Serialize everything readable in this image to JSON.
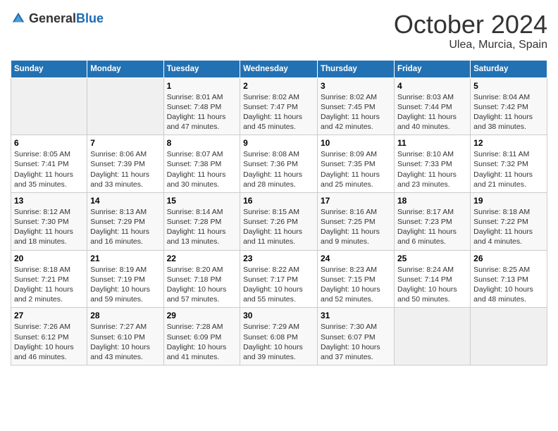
{
  "header": {
    "logo_general": "General",
    "logo_blue": "Blue",
    "month": "October 2024",
    "location": "Ulea, Murcia, Spain"
  },
  "days_of_week": [
    "Sunday",
    "Monday",
    "Tuesday",
    "Wednesday",
    "Thursday",
    "Friday",
    "Saturday"
  ],
  "weeks": [
    [
      {
        "day": "",
        "info": ""
      },
      {
        "day": "",
        "info": ""
      },
      {
        "day": "1",
        "info": "Sunrise: 8:01 AM\nSunset: 7:48 PM\nDaylight: 11 hours and 47 minutes."
      },
      {
        "day": "2",
        "info": "Sunrise: 8:02 AM\nSunset: 7:47 PM\nDaylight: 11 hours and 45 minutes."
      },
      {
        "day": "3",
        "info": "Sunrise: 8:02 AM\nSunset: 7:45 PM\nDaylight: 11 hours and 42 minutes."
      },
      {
        "day": "4",
        "info": "Sunrise: 8:03 AM\nSunset: 7:44 PM\nDaylight: 11 hours and 40 minutes."
      },
      {
        "day": "5",
        "info": "Sunrise: 8:04 AM\nSunset: 7:42 PM\nDaylight: 11 hours and 38 minutes."
      }
    ],
    [
      {
        "day": "6",
        "info": "Sunrise: 8:05 AM\nSunset: 7:41 PM\nDaylight: 11 hours and 35 minutes."
      },
      {
        "day": "7",
        "info": "Sunrise: 8:06 AM\nSunset: 7:39 PM\nDaylight: 11 hours and 33 minutes."
      },
      {
        "day": "8",
        "info": "Sunrise: 8:07 AM\nSunset: 7:38 PM\nDaylight: 11 hours and 30 minutes."
      },
      {
        "day": "9",
        "info": "Sunrise: 8:08 AM\nSunset: 7:36 PM\nDaylight: 11 hours and 28 minutes."
      },
      {
        "day": "10",
        "info": "Sunrise: 8:09 AM\nSunset: 7:35 PM\nDaylight: 11 hours and 25 minutes."
      },
      {
        "day": "11",
        "info": "Sunrise: 8:10 AM\nSunset: 7:33 PM\nDaylight: 11 hours and 23 minutes."
      },
      {
        "day": "12",
        "info": "Sunrise: 8:11 AM\nSunset: 7:32 PM\nDaylight: 11 hours and 21 minutes."
      }
    ],
    [
      {
        "day": "13",
        "info": "Sunrise: 8:12 AM\nSunset: 7:30 PM\nDaylight: 11 hours and 18 minutes."
      },
      {
        "day": "14",
        "info": "Sunrise: 8:13 AM\nSunset: 7:29 PM\nDaylight: 11 hours and 16 minutes."
      },
      {
        "day": "15",
        "info": "Sunrise: 8:14 AM\nSunset: 7:28 PM\nDaylight: 11 hours and 13 minutes."
      },
      {
        "day": "16",
        "info": "Sunrise: 8:15 AM\nSunset: 7:26 PM\nDaylight: 11 hours and 11 minutes."
      },
      {
        "day": "17",
        "info": "Sunrise: 8:16 AM\nSunset: 7:25 PM\nDaylight: 11 hours and 9 minutes."
      },
      {
        "day": "18",
        "info": "Sunrise: 8:17 AM\nSunset: 7:23 PM\nDaylight: 11 hours and 6 minutes."
      },
      {
        "day": "19",
        "info": "Sunrise: 8:18 AM\nSunset: 7:22 PM\nDaylight: 11 hours and 4 minutes."
      }
    ],
    [
      {
        "day": "20",
        "info": "Sunrise: 8:18 AM\nSunset: 7:21 PM\nDaylight: 11 hours and 2 minutes."
      },
      {
        "day": "21",
        "info": "Sunrise: 8:19 AM\nSunset: 7:19 PM\nDaylight: 10 hours and 59 minutes."
      },
      {
        "day": "22",
        "info": "Sunrise: 8:20 AM\nSunset: 7:18 PM\nDaylight: 10 hours and 57 minutes."
      },
      {
        "day": "23",
        "info": "Sunrise: 8:22 AM\nSunset: 7:17 PM\nDaylight: 10 hours and 55 minutes."
      },
      {
        "day": "24",
        "info": "Sunrise: 8:23 AM\nSunset: 7:15 PM\nDaylight: 10 hours and 52 minutes."
      },
      {
        "day": "25",
        "info": "Sunrise: 8:24 AM\nSunset: 7:14 PM\nDaylight: 10 hours and 50 minutes."
      },
      {
        "day": "26",
        "info": "Sunrise: 8:25 AM\nSunset: 7:13 PM\nDaylight: 10 hours and 48 minutes."
      }
    ],
    [
      {
        "day": "27",
        "info": "Sunrise: 7:26 AM\nSunset: 6:12 PM\nDaylight: 10 hours and 46 minutes."
      },
      {
        "day": "28",
        "info": "Sunrise: 7:27 AM\nSunset: 6:10 PM\nDaylight: 10 hours and 43 minutes."
      },
      {
        "day": "29",
        "info": "Sunrise: 7:28 AM\nSunset: 6:09 PM\nDaylight: 10 hours and 41 minutes."
      },
      {
        "day": "30",
        "info": "Sunrise: 7:29 AM\nSunset: 6:08 PM\nDaylight: 10 hours and 39 minutes."
      },
      {
        "day": "31",
        "info": "Sunrise: 7:30 AM\nSunset: 6:07 PM\nDaylight: 10 hours and 37 minutes."
      },
      {
        "day": "",
        "info": ""
      },
      {
        "day": "",
        "info": ""
      }
    ]
  ]
}
